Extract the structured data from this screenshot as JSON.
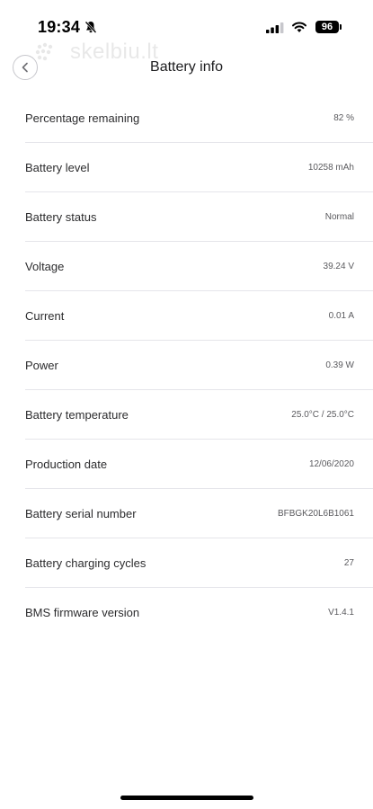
{
  "status_bar": {
    "time": "19:34",
    "battery_percent": "96",
    "icons": [
      "bell-slash-icon",
      "cellular-signal-icon",
      "wifi-icon",
      "battery-icon"
    ]
  },
  "watermark": {
    "text": "skelbiu.lt"
  },
  "header": {
    "title": "Battery info",
    "back_icon": "chevron-left-icon"
  },
  "rows": [
    {
      "label": "Percentage remaining",
      "value": "82 %"
    },
    {
      "label": "Battery level",
      "value": "10258 mAh"
    },
    {
      "label": "Battery status",
      "value": "Normal"
    },
    {
      "label": "Voltage",
      "value": "39.24 V"
    },
    {
      "label": "Current",
      "value": "0.01 A"
    },
    {
      "label": "Power",
      "value": "0.39 W"
    },
    {
      "label": "Battery temperature",
      "value": "25.0°C / 25.0°C"
    },
    {
      "label": "Production date",
      "value": "12/06/2020"
    },
    {
      "label": "Battery serial number",
      "value": "BFBGK20L6B1061"
    },
    {
      "label": "Battery charging cycles",
      "value": "27"
    },
    {
      "label": "BMS firmware version",
      "value": "V1.4.1"
    }
  ],
  "colors": {
    "text": "#1c1c1e",
    "value_text": "#5a5a5e",
    "divider": "#e5e5ea",
    "back_border": "#c7c7cc"
  }
}
